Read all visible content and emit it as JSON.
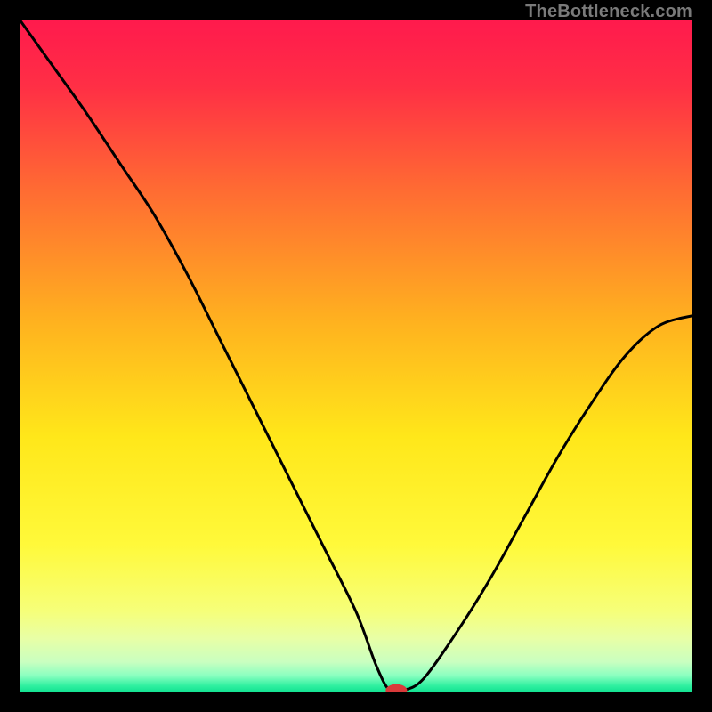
{
  "watermark": "TheBottleneck.com",
  "chart_data": {
    "type": "line",
    "title": "",
    "xlabel": "",
    "ylabel": "",
    "xlim": [
      0,
      100
    ],
    "ylim": [
      0,
      100
    ],
    "series": [
      {
        "name": "curve",
        "x": [
          0,
          5,
          10,
          15,
          20,
          25,
          30,
          35,
          40,
          45,
          50,
          53,
          55,
          57,
          60,
          65,
          70,
          75,
          80,
          85,
          90,
          95,
          100
        ],
        "y": [
          100,
          93,
          86,
          78.5,
          71,
          62,
          52,
          42,
          32,
          22,
          12,
          4,
          0.3,
          0.3,
          2,
          9,
          17,
          26,
          35,
          43,
          50,
          54.5,
          56
        ]
      }
    ],
    "marker": {
      "x": 56,
      "y": 0.3,
      "color": "#d93a3a",
      "rx": 12,
      "ry": 7
    },
    "gradient_stops": [
      {
        "offset": 0.0,
        "color": "#ff1a4d"
      },
      {
        "offset": 0.1,
        "color": "#ff2f45"
      },
      {
        "offset": 0.25,
        "color": "#ff6a33"
      },
      {
        "offset": 0.45,
        "color": "#ffb21f"
      },
      {
        "offset": 0.62,
        "color": "#ffe71a"
      },
      {
        "offset": 0.78,
        "color": "#fff93a"
      },
      {
        "offset": 0.88,
        "color": "#f6ff7a"
      },
      {
        "offset": 0.92,
        "color": "#e8ffa6"
      },
      {
        "offset": 0.955,
        "color": "#c9ffc0"
      },
      {
        "offset": 0.975,
        "color": "#8affc0"
      },
      {
        "offset": 0.99,
        "color": "#30f0a0"
      },
      {
        "offset": 1.0,
        "color": "#10e090"
      }
    ]
  }
}
